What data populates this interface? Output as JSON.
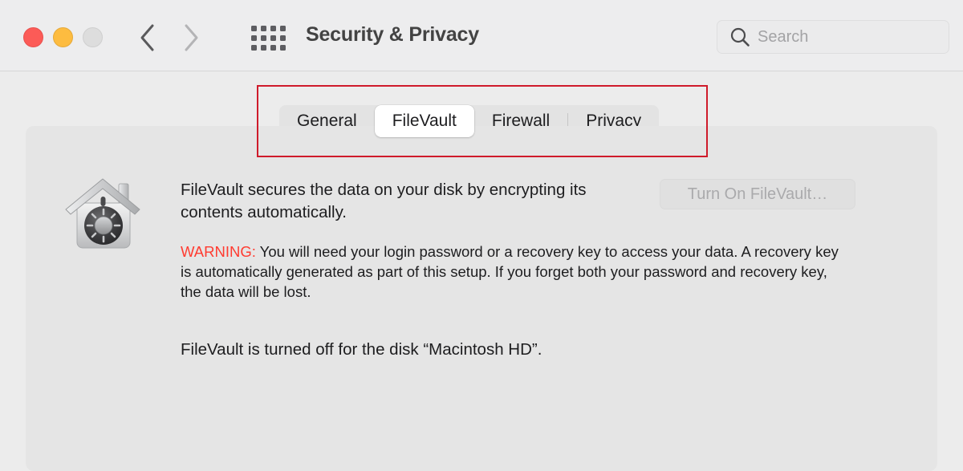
{
  "window": {
    "title": "Security & Privacy",
    "traffic_lights": [
      {
        "name": "close",
        "color": "#fc5b57"
      },
      {
        "name": "minimize",
        "color": "#fdbc40"
      },
      {
        "name": "zoom",
        "color": "#dddddd"
      }
    ],
    "nav": {
      "back_label": "Back",
      "forward_label": "Forward",
      "show_all_label": "Show All"
    }
  },
  "search": {
    "placeholder": "Search",
    "value": ""
  },
  "tabs": {
    "items": [
      {
        "label": "General",
        "selected": false
      },
      {
        "label": "FileVault",
        "selected": true
      },
      {
        "label": "Firewall",
        "selected": false
      },
      {
        "label": "Privacy",
        "selected": false
      }
    ],
    "selected": "FileVault"
  },
  "annotation": {
    "color": "#cf1b2b",
    "target": "tabs"
  },
  "filevault": {
    "icon_name": "filevault-house-safe-icon",
    "description": "FileVault secures the data on your disk by encrypting its contents automatically.",
    "warning_label": "WARNING:",
    "warning_color": "#ff3b30",
    "warning_text": " You will need your login password or a recovery key to access your data. A recovery key is automatically generated as part of this setup. If you forget both your password and recovery key, the data will be lost.",
    "status": "FileVault is turned off for the disk “Macintosh HD”.",
    "turn_on_button": "Turn On FileVault…",
    "turn_on_button_enabled": false
  }
}
